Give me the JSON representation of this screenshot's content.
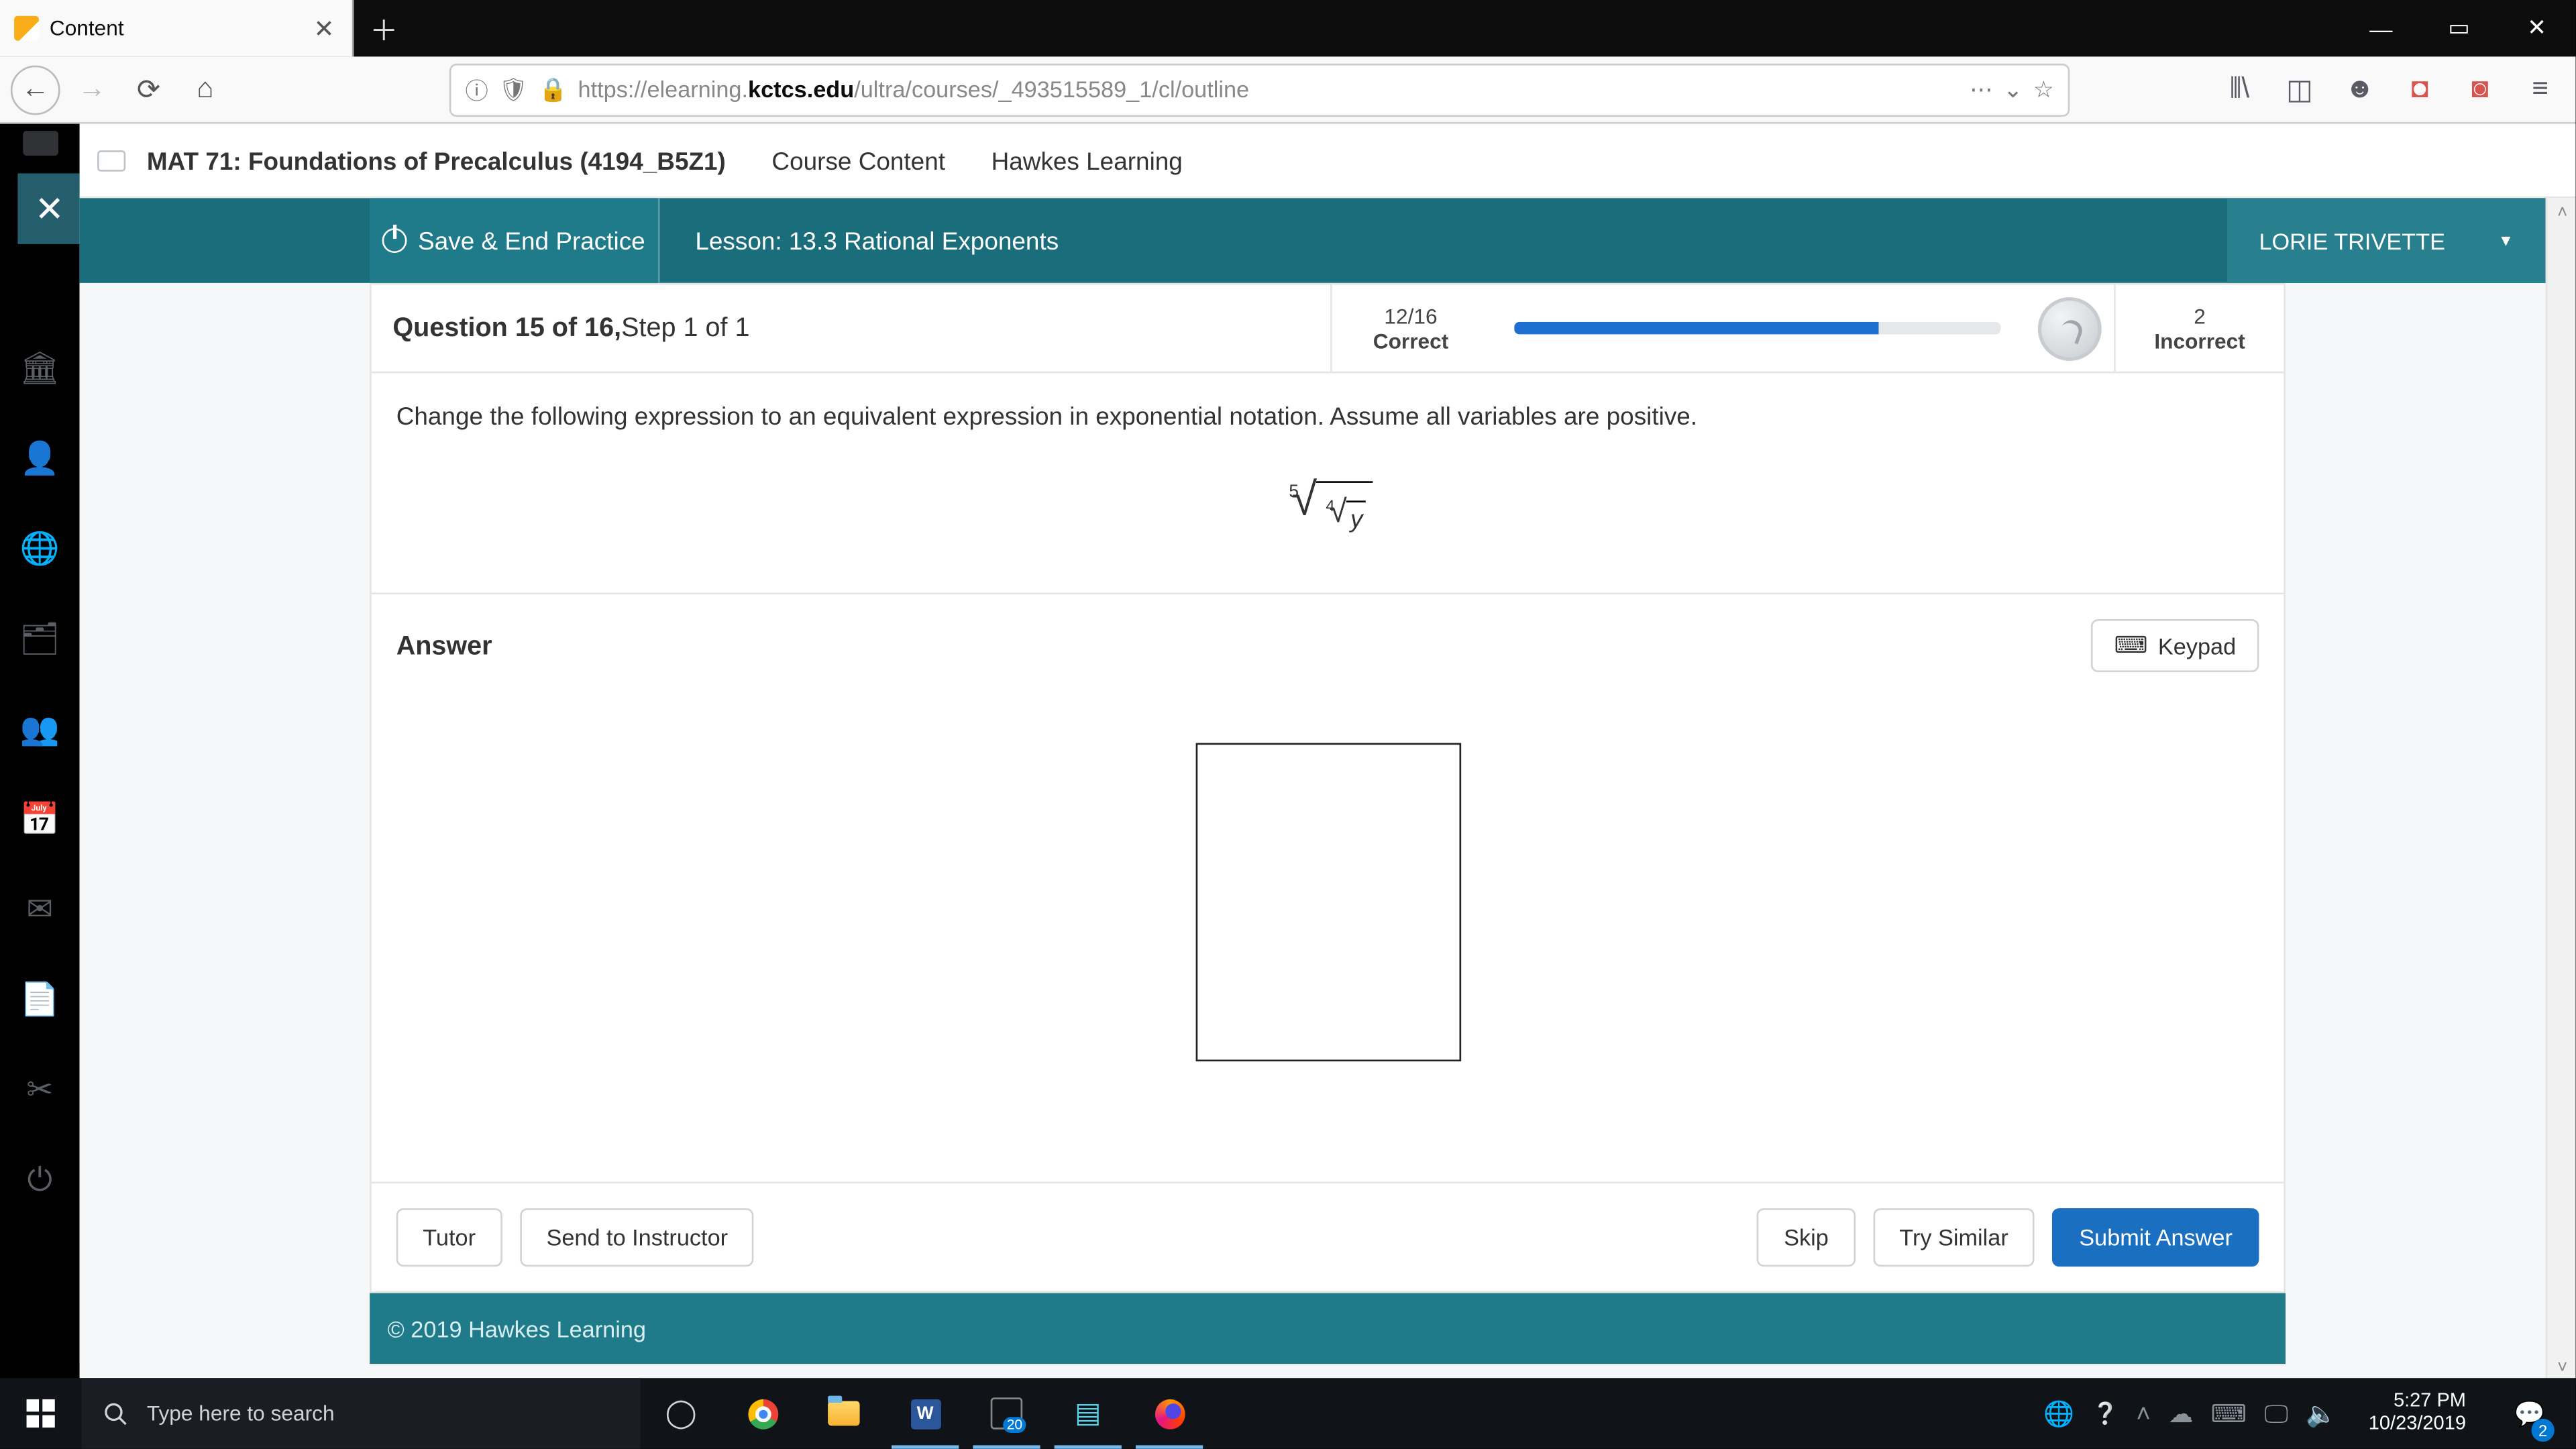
{
  "browser": {
    "tab_title": "Content",
    "url_plain_before": "https://elearning.",
    "url_bold": "kctcs.edu",
    "url_plain_after": "/ultra/courses/_493515589_1/cl/outline"
  },
  "coursebar": {
    "course": "MAT 71: Foundations of Precalculus (4194_B5Z1)",
    "crumb1": "Course Content",
    "crumb2": "Hawkes Learning"
  },
  "hawkes": {
    "save_label": "Save & End Practice",
    "lesson_label": "Lesson: 13.3 Rational Exponents",
    "user_name": "LORIE TRIVETTE",
    "question_label_a": "Question 15 of 16,  ",
    "question_label_b": "Step 1 of 1",
    "correct_count": "12/16",
    "correct_label": "Correct",
    "incorrect_count": "2",
    "incorrect_label": "Incorrect",
    "progress_pct": 75,
    "prompt": "Change the following expression to an equivalent expression in exponential notation. Assume all variables are positive.",
    "outer_index": "5",
    "inner_index": "4",
    "radicand": "y",
    "answer_heading": "Answer",
    "keypad_label": "Keypad",
    "btn_tutor": "Tutor",
    "btn_send": "Send to Instructor",
    "btn_skip": "Skip",
    "btn_try": "Try Similar",
    "btn_submit": "Submit Answer",
    "footer": "© 2019 Hawkes Learning"
  },
  "taskbar": {
    "search_placeholder": "Type here to search",
    "time": "5:27 PM",
    "date": "10/23/2019",
    "notif_count": "2"
  }
}
